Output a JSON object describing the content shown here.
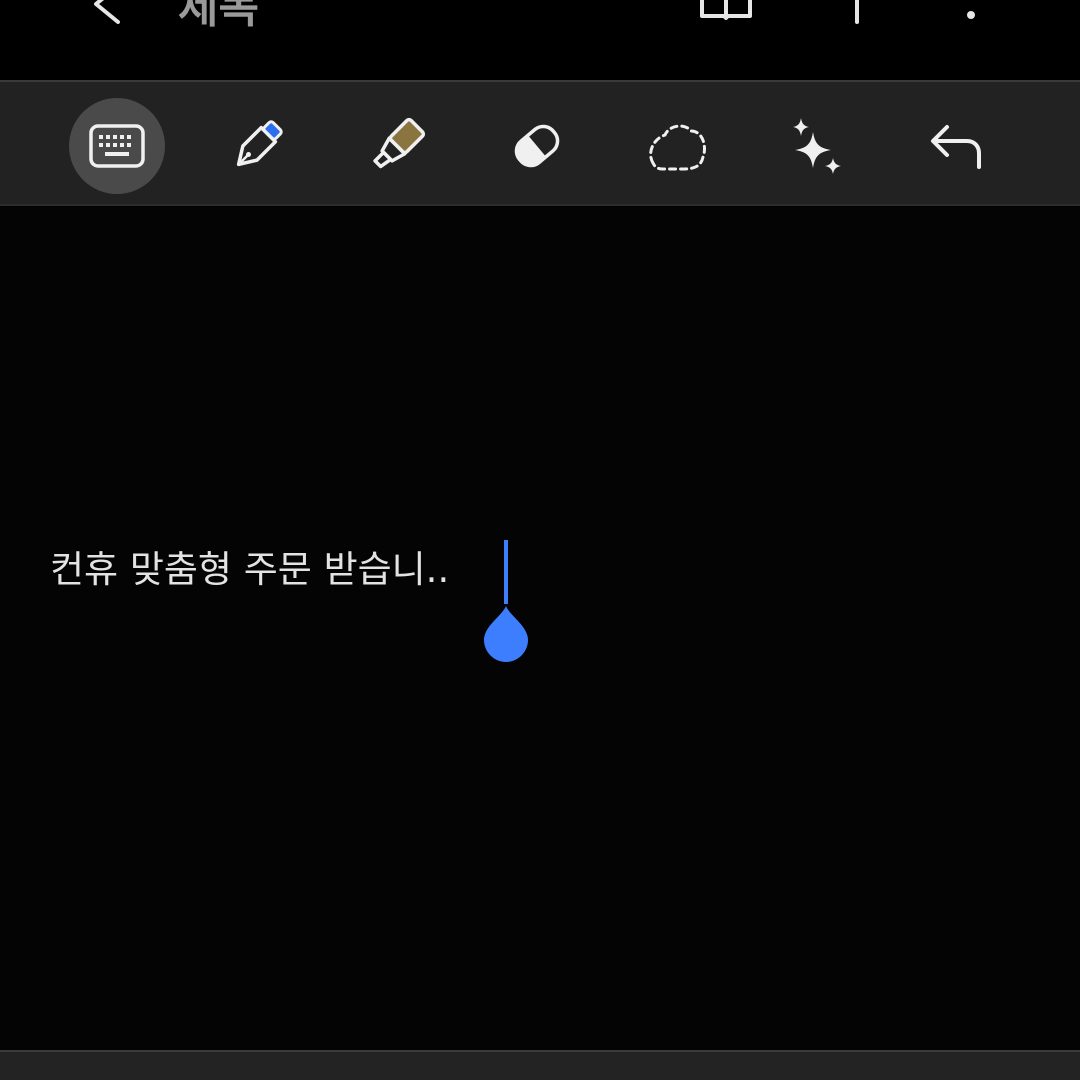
{
  "app_bar": {
    "title": "제목",
    "icons": [
      "back-icon",
      "book-icon",
      "share-icon",
      "more-icon"
    ]
  },
  "toolbar": {
    "tools": [
      {
        "name": "keyboard",
        "icon": "keyboard-icon",
        "active": true
      },
      {
        "name": "pen",
        "icon": "pen-icon",
        "active": false
      },
      {
        "name": "highlighter",
        "icon": "highlighter-icon",
        "active": false
      },
      {
        "name": "eraser",
        "icon": "eraser-icon",
        "active": false
      },
      {
        "name": "lasso",
        "icon": "lasso-icon",
        "active": false
      },
      {
        "name": "ai-assist",
        "icon": "sparkle-icon",
        "active": false
      },
      {
        "name": "undo",
        "icon": "undo-icon",
        "active": false
      }
    ]
  },
  "editor": {
    "content": "컨휴 맞춤형 주문 받습니.."
  },
  "colors": {
    "background": "#000000",
    "toolbar_bg": "#222222",
    "active_tool_bg": "#4a4a4a",
    "text": "#e3e3e3",
    "accent": "#3d7eff",
    "highlighter": "#8a7440",
    "pen_tip": "#2f6df0"
  }
}
